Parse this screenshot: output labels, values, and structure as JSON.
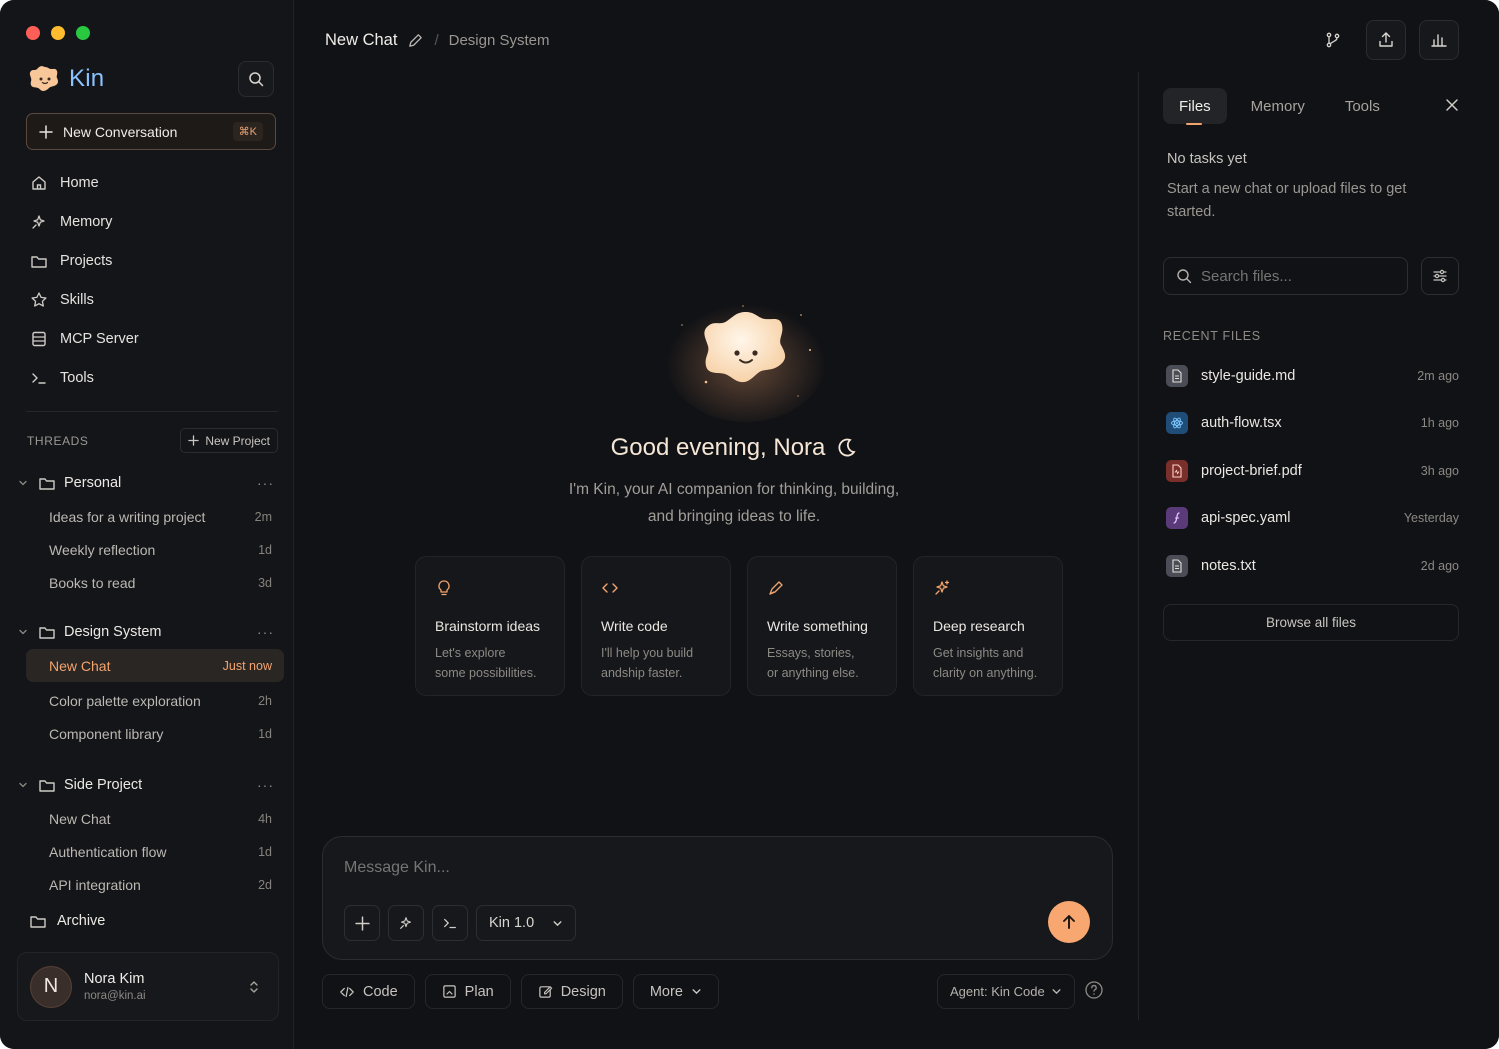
{
  "brand": {
    "name": "Kin"
  },
  "sidebar": {
    "new_conversation": "New Conversation",
    "new_conversation_shortcut": "⌘K",
    "nav": [
      {
        "label": "Home",
        "icon": "home-icon"
      },
      {
        "label": "Memory",
        "icon": "sparkle-icon"
      },
      {
        "label": "Projects",
        "icon": "folder-icon"
      },
      {
        "label": "Skills",
        "icon": "star-icon"
      },
      {
        "label": "MCP Server",
        "icon": "server-icon"
      },
      {
        "label": "Tools",
        "icon": "terminal-icon"
      }
    ],
    "threads_label": "THREADS",
    "new_project": "New Project",
    "groups": [
      {
        "name": "Personal",
        "threads": [
          {
            "title": "Ideas for a writing project",
            "time": "2m"
          },
          {
            "title": "Weekly reflection",
            "time": "1d"
          },
          {
            "title": "Books to read",
            "time": "3d"
          }
        ]
      },
      {
        "name": "Design System",
        "threads": [
          {
            "title": "New Chat",
            "time": "Just now",
            "active": true
          },
          {
            "title": "Color palette exploration",
            "time": "2h"
          },
          {
            "title": "Component library",
            "time": "1d"
          }
        ]
      },
      {
        "name": "Side Project",
        "threads": [
          {
            "title": "New Chat",
            "time": "4h"
          },
          {
            "title": "Authentication flow",
            "time": "1d"
          },
          {
            "title": "API integration",
            "time": "2d"
          }
        ]
      }
    ],
    "archive": "Archive",
    "user": {
      "initial": "N",
      "name": "Nora Kim",
      "email": "nora@kin.ai"
    }
  },
  "header": {
    "title": "New Chat",
    "separator": "/",
    "project": "Design System"
  },
  "hero": {
    "greeting": "Good evening, Nora",
    "subtitle_line1": "I'm Kin, your AI companion for thinking, building,",
    "subtitle_line2": "and bringing ideas to life."
  },
  "cards": [
    {
      "icon": "lightbulb-icon",
      "title": "Brainstorm ideas",
      "line1": "Let's explore",
      "line2": "some possibilities."
    },
    {
      "icon": "code-icon",
      "title": "Write code",
      "line1": "I'll help you build",
      "line2": "andship faster."
    },
    {
      "icon": "pen-icon",
      "title": "Write something",
      "line1": "Essays, stories,",
      "line2": "or anything else."
    },
    {
      "icon": "sparkles-icon",
      "title": "Deep research",
      "line1": "Get insights and",
      "line2": "clarity on anything."
    }
  ],
  "composer": {
    "placeholder": "Message Kin...",
    "model": "Kin 1.0"
  },
  "modes": [
    {
      "label": "Code",
      "icon": "code-icon"
    },
    {
      "label": "Plan",
      "icon": "plan-icon"
    },
    {
      "label": "Design",
      "icon": "edit-icon"
    },
    {
      "label": "More",
      "icon": "chevron-down-icon"
    }
  ],
  "agent": "Agent: Kin Code",
  "panel": {
    "tabs": [
      "Files",
      "Memory",
      "Tools"
    ],
    "active_tab": "Files",
    "empty_title": "No tasks yet",
    "empty_desc": "Start a new chat or upload files to get started.",
    "search_placeholder": "Search files...",
    "recent_label": "RECENT FILES",
    "files": [
      {
        "name": "style-guide.md",
        "time": "2m ago",
        "color": "#4a4d55"
      },
      {
        "name": "auth-flow.tsx",
        "time": "1h ago",
        "color": "#1f4d78"
      },
      {
        "name": "project-brief.pdf",
        "time": "3h ago",
        "color": "#7a2f2a"
      },
      {
        "name": "api-spec.yaml",
        "time": "Yesterday",
        "color": "#5a3a78"
      },
      {
        "name": "notes.txt",
        "time": "2d ago",
        "color": "#4a4d55"
      }
    ],
    "browse": "Browse all files"
  },
  "colors": {
    "accent": "#f8a771",
    "brand_blue": "#8cc3ff",
    "traffic_red": "#ff5f57",
    "traffic_yellow": "#febc2e",
    "traffic_green": "#28c840"
  }
}
